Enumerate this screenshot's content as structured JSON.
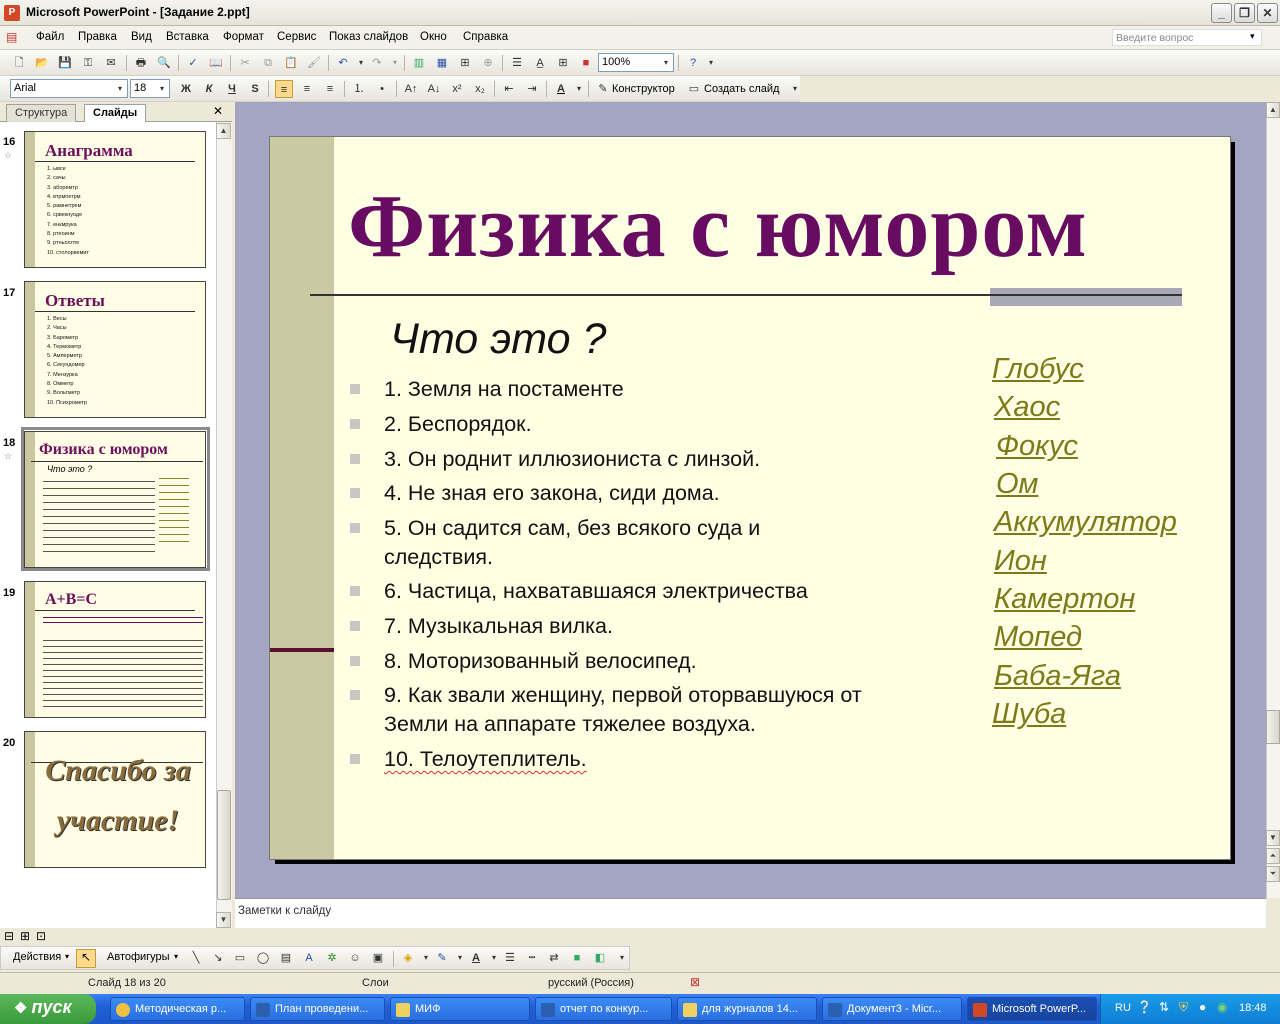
{
  "window": {
    "title": "Microsoft PowerPoint - [Задание 2.ppt]",
    "app_icon": "P",
    "minimize": "_",
    "restore": "❐",
    "close": "✕"
  },
  "menu": {
    "items": [
      "Файл",
      "Правка",
      "Вид",
      "Вставка",
      "Формат",
      "Сервис",
      "Показ слайдов",
      "Окно",
      "Справка"
    ],
    "ask_placeholder": "Введите вопрос"
  },
  "toolbar1": {
    "zoom": "100%"
  },
  "toolbar2": {
    "font": "Arial",
    "size": "18",
    "bold": "Ж",
    "italic": "К",
    "underline": "Ч",
    "shadow": "S",
    "designer": "Конструктор",
    "new_slide": "Создать слайд"
  },
  "panes": {
    "tab_outline": "Структура",
    "tab_slides": "Слайды",
    "close": "✕"
  },
  "thumbnails": [
    {
      "num": "16",
      "title": "Анаграмма",
      "items": [
        "1. ывсе",
        "2. сачы",
        "3. аборемтр",
        "4. втрмоетрм",
        "5. рамнетрем",
        "6. срвекнуоде",
        "7. енкмрука",
        "8. ртеоинм",
        "9. ртньоллте",
        "10. столорвемит"
      ]
    },
    {
      "num": "17",
      "title": "Ответы",
      "items": [
        "1. Весы",
        "2. Часы",
        "3. Барометр",
        "4. Термометр",
        "5. Амперметр",
        "6. Секундомер",
        "7. Мензурка",
        "8. Омметр",
        "9. Вольтметр",
        "10. Психрометр"
      ]
    },
    {
      "num": "18",
      "title": "Физика с юмором"
    },
    {
      "num": "19",
      "title": "А+В=С"
    },
    {
      "num": "20",
      "title": "Спасибо за участие!"
    }
  ],
  "slide": {
    "title": "Физика с юмором",
    "subtitle": "Что это ?",
    "questions": [
      "1. Земля на постаменте",
      "2. Беспорядок.",
      "3. Он роднит иллюзиониста с линзой.",
      "4. Не зная его закона, сиди дома.",
      "5. Он садится сам, без всякого суда и следствия.",
      "6. Частица, нахватавшаяся электричества",
      "7. Музыкальная вилка.",
      "8. Моторизованный велосипед.",
      "9. Как звали женщину, первой оторвавшуюся от Земли на аппарате тяжелее воздуха.",
      "10. Телоутеплитель."
    ],
    "answers": [
      "Глобус",
      "Хаос",
      "Фокус",
      "Ом",
      "Аккумулятор",
      "Ион",
      "Камертон",
      "Мопед",
      "Баба-Яга",
      "Шуба"
    ]
  },
  "notes": {
    "placeholder": "Заметки к слайду"
  },
  "drawbar": {
    "actions": "Действия",
    "autoshapes": "Автофигуры"
  },
  "status": {
    "slide": "Слайд 18 из 20",
    "design": "Слои",
    "language": "русский (Россия)"
  },
  "taskbar": {
    "start": "пуск",
    "tasks": [
      "Методическая р...",
      "План проведени...",
      "МИФ",
      "отчет по конкур...",
      "для журналов 14...",
      "Документ3 - Micr...",
      "Microsoft PowerP..."
    ],
    "lang": "RU",
    "clock": "18:48"
  },
  "colors": {
    "title": "#680c62",
    "answer": "#7d7a19",
    "slide_bg": "#ffffe3",
    "taskbar": "#2160d6"
  }
}
